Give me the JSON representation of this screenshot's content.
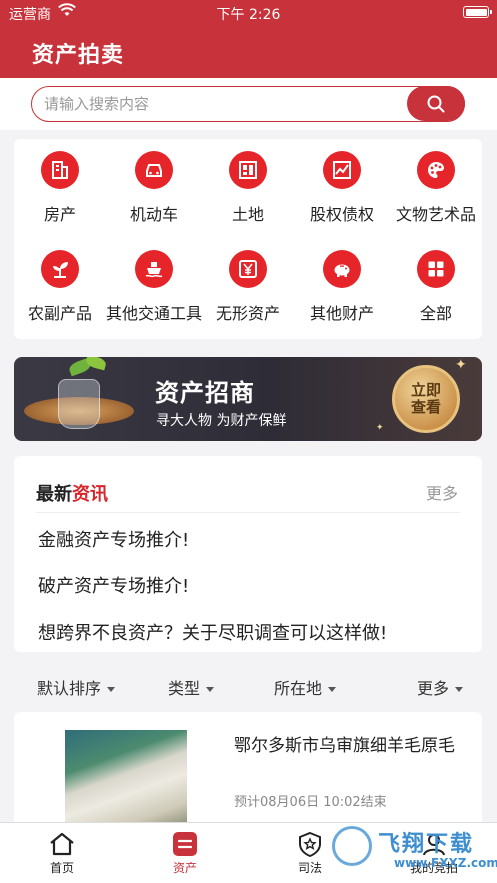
{
  "status_bar": {
    "carrier": "运营商",
    "time": "下午 2:26"
  },
  "header": {
    "title": "资产拍卖"
  },
  "search": {
    "placeholder": "请输入搜索内容"
  },
  "categories": [
    {
      "label": "房产",
      "icon": "building-icon"
    },
    {
      "label": "机动车",
      "icon": "car-icon"
    },
    {
      "label": "土地",
      "icon": "land-grid-icon"
    },
    {
      "label": "股权债权",
      "icon": "trend-chart-icon"
    },
    {
      "label": "文物艺术品",
      "icon": "palette-icon"
    },
    {
      "label": "农副产品",
      "icon": "sprout-icon"
    },
    {
      "label": "其他交通工具",
      "icon": "ship-icon"
    },
    {
      "label": "无形资产",
      "icon": "yen-icon"
    },
    {
      "label": "其他财产",
      "icon": "piggy-bank-icon"
    },
    {
      "label": "全部",
      "icon": "all-grid-icon"
    }
  ],
  "banner": {
    "title": "资产招商",
    "subtitle": "寻大人物 为财产保鲜",
    "cta": "立即\n查看"
  },
  "news": {
    "heading_black": "最新",
    "heading_red": "资讯",
    "more": "更多",
    "items": [
      "金融资产专场推介!",
      "破产资产专场推介!",
      "想跨界不良资产？关于尽职调查可以这样做!"
    ]
  },
  "filters": [
    "默认排序",
    "类型",
    "所在地",
    "更多"
  ],
  "listing": {
    "title": "鄂尔多斯市乌审旗细羊毛原毛",
    "end_time": "预计08月06日 10:02结束"
  },
  "tabs": [
    {
      "label": "首页",
      "icon": "home-icon"
    },
    {
      "label": "资产",
      "icon": "asset-icon"
    },
    {
      "label": "司法",
      "icon": "justice-icon"
    },
    {
      "label": "我的竞拍",
      "icon": "my-bids-icon"
    }
  ],
  "watermark": {
    "text": "飞翔下载",
    "url": "www.FXXZ.com"
  },
  "colors": {
    "brand": "#c8323a",
    "icon_bg": "#e5252a",
    "accent_text": "#d9262c"
  }
}
